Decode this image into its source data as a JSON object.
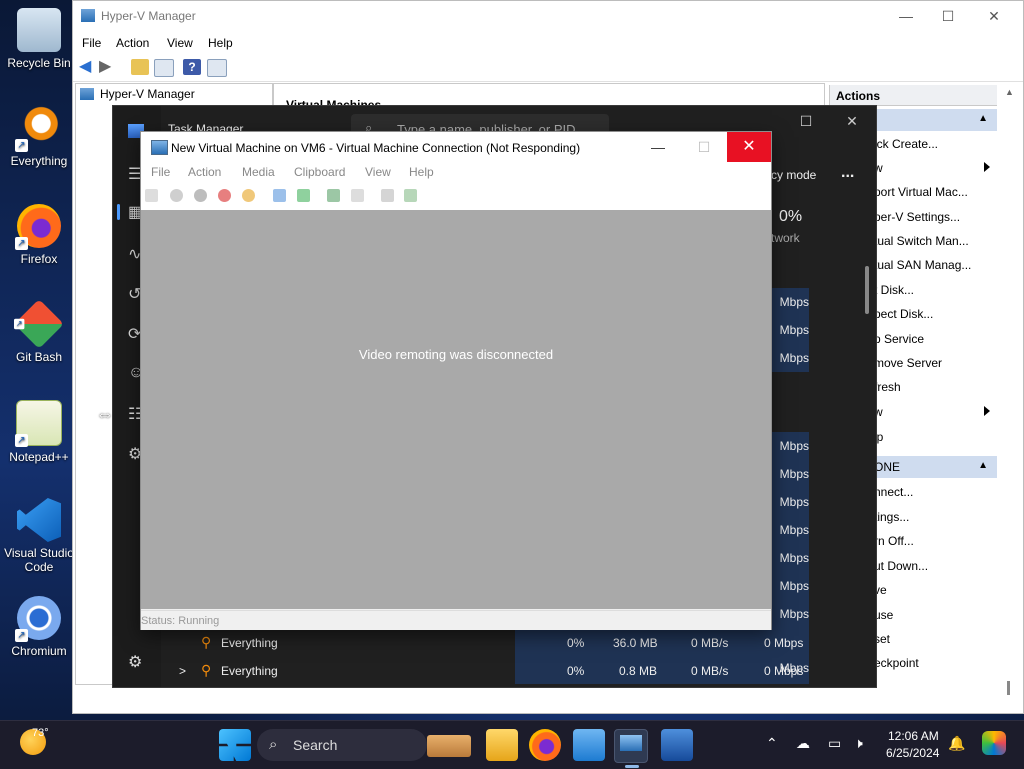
{
  "desktop": {
    "icons": [
      {
        "label": "Recycle Bin",
        "icon": "recycle-bin-icon"
      },
      {
        "label": "Everything",
        "icon": "everything-search-icon"
      },
      {
        "label": "Firefox",
        "icon": "firefox-icon"
      },
      {
        "label": "Git Bash",
        "icon": "git-bash-icon"
      },
      {
        "label": "Notepad++",
        "icon": "notepad-plus-plus-icon"
      },
      {
        "label": "Visual Studio Code",
        "icon": "vscode-icon"
      },
      {
        "label": "Chromium",
        "icon": "chromium-icon"
      }
    ]
  },
  "hyperv": {
    "title": "Hyper-V Manager",
    "menu": [
      "File",
      "Action",
      "View",
      "Help"
    ],
    "tree_root": "Hyper-V Manager",
    "center_header": "Virtual Machines",
    "actions_header": "Actions",
    "actions_host": [
      {
        "label": "ick Create...",
        "arrow": false
      },
      {
        "label": "w",
        "arrow": true
      },
      {
        "label": "port Virtual Mac...",
        "arrow": false
      },
      {
        "label": "per-V Settings...",
        "arrow": false
      },
      {
        "label": "tual Switch Man...",
        "arrow": false
      },
      {
        "label": "tual SAN Manag...",
        "arrow": false
      },
      {
        "label": "t Disk...",
        "arrow": false
      },
      {
        "label": "pect Disk...",
        "arrow": false
      },
      {
        "label": "p Service",
        "arrow": false
      },
      {
        "label": "move Server",
        "arrow": false
      },
      {
        "label": "fresh",
        "arrow": false
      },
      {
        "label": "w",
        "arrow": true
      },
      {
        "label": "lp",
        "arrow": false
      }
    ],
    "vm_section": "ONE",
    "actions_vm": [
      "nnect...",
      "tings...",
      "rn Off...",
      "ut Down...",
      "ve",
      "use",
      "set",
      "eckpoint"
    ]
  },
  "taskmgr": {
    "title": "Task Manager",
    "search_placeholder": "Type a name, publisher, or PID",
    "efficiency": "cy mode",
    "more": "...",
    "network_pct": "0%",
    "network_label": "twork",
    "mbps_rows": [
      "Mbps",
      "Mbps",
      "Mbps",
      "Mbps",
      "Mbps",
      "Mbps",
      "Mbps",
      "Mbps",
      "Mbps",
      "Mbps",
      "Mbps"
    ],
    "processes": [
      {
        "name": "Everything",
        "cpu": "0%",
        "mem": "36.0 MB",
        "disk": "0 MB/s",
        "net": "0 Mbps",
        "expand": ""
      },
      {
        "name": "Everything",
        "cpu": "0%",
        "mem": "0.8 MB",
        "disk": "0 MB/s",
        "net": "0 Mbps",
        "expand": ">"
      }
    ]
  },
  "vmconnect": {
    "title": "New Virtual Machine on VM6 - Virtual Machine Connection (Not Responding)",
    "menu": [
      "File",
      "Action",
      "Media",
      "Clipboard",
      "View",
      "Help"
    ],
    "message": "Video remoting was disconnected",
    "status": "Status: Running"
  },
  "taskbar": {
    "weather_temp": "73°",
    "search_label": "Search",
    "time": "12:06 AM",
    "date": "6/25/2024"
  }
}
